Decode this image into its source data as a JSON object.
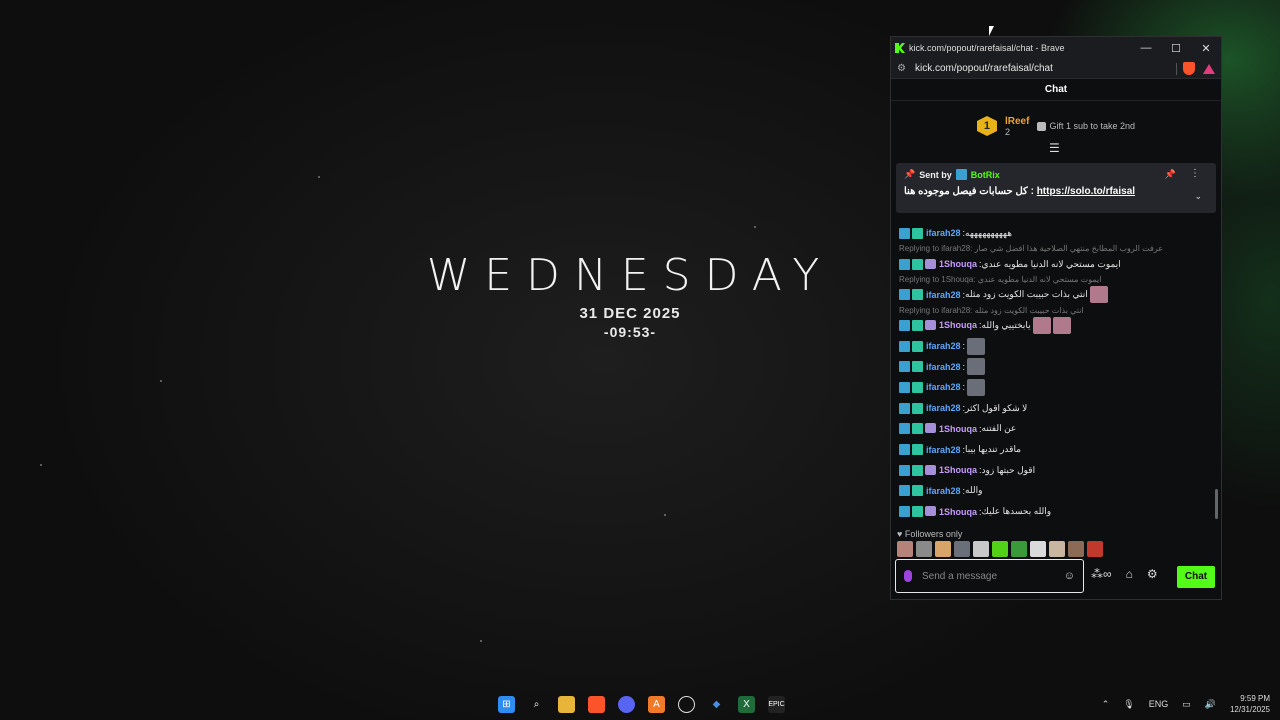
{
  "desktop": {
    "day": "WEDNESDAY",
    "date": "31 DEC 2025",
    "time": "-09:53-"
  },
  "browser": {
    "title": "kick.com/popout/rarefaisal/chat - Brave",
    "url": "kick.com/popout/rarefaisal/chat",
    "buttons": {
      "minimize": "—",
      "maximize": "☐",
      "close": "✕"
    }
  },
  "chat": {
    "header": "Chat",
    "leaderboard": {
      "rank": "1",
      "name": "lReef",
      "count": "2",
      "gift_text": "Gift 1 sub to take 2nd"
    },
    "pinned": {
      "sent_by": "Sent by",
      "bot_name": "BotRix",
      "text": "كل حسابات فيصل موجوده هنا : ",
      "link": "https://solo.to/rfaisal"
    },
    "messages": [
      {
        "type": "msg",
        "user": "ifarah28",
        "userclass": "u-farah",
        "badge3": false,
        "text": "ههههههههههه",
        "emotes": 0
      },
      {
        "type": "reply",
        "text": "Replying to ifarah28: عرفت الروب المطابخ منتهي الصلاحية هذا افضل شي صار"
      },
      {
        "type": "msg",
        "user": "1Shouqa",
        "userclass": "u-shouqa",
        "badge3": true,
        "text": "ايموت مستحي لانه الدنيا مطويه عندي",
        "emotes": 0
      },
      {
        "type": "reply",
        "text": "Replying to 1Shouqa: ايموت مستحي لانه الدنيا مطويه عندي"
      },
      {
        "type": "msg",
        "user": "ifarah28",
        "userclass": "u-farah",
        "badge3": false,
        "text": "انتي بذات حبيبت الكويت زود مثله",
        "emotes": 1
      },
      {
        "type": "reply",
        "text": "Replying to ifarah28: انتي بذات حبيبت الكويت زود مثله"
      },
      {
        "type": "msg",
        "user": "1Shouqa",
        "userclass": "u-shouqa",
        "badge3": true,
        "text": "يابختييي والله",
        "emotes": 2
      },
      {
        "type": "msg",
        "user": "ifarah28",
        "userclass": "u-farah",
        "badge3": false,
        "text": "",
        "emotes": 1
      },
      {
        "type": "msg",
        "user": "ifarah28",
        "userclass": "u-farah",
        "badge3": false,
        "text": "",
        "emotes": 1
      },
      {
        "type": "msg",
        "user": "ifarah28",
        "userclass": "u-farah",
        "badge3": false,
        "text": "",
        "emotes": 1
      },
      {
        "type": "msg",
        "user": "ifarah28",
        "userclass": "u-farah",
        "badge3": false,
        "text": "لا شكو اقول اكثر",
        "emotes": 0
      },
      {
        "type": "msg",
        "user": "1Shouqa",
        "userclass": "u-shouqa",
        "badge3": true,
        "text": "عن الفتنه",
        "emotes": 0
      },
      {
        "type": "msg",
        "user": "ifarah28",
        "userclass": "u-farah",
        "badge3": false,
        "text": "ماقدر تنديها بيبا",
        "emotes": 0
      },
      {
        "type": "msg",
        "user": "1Shouqa",
        "userclass": "u-shouqa",
        "badge3": true,
        "text": "اقول حبتها زود",
        "emotes": 0
      },
      {
        "type": "msg",
        "user": "ifarah28",
        "userclass": "u-farah",
        "badge3": false,
        "text": "والله",
        "emotes": 0
      },
      {
        "type": "msg",
        "user": "1Shouqa",
        "userclass": "u-shouqa",
        "badge3": true,
        "text": "والله بحسدها عليك",
        "emotes": 0
      }
    ],
    "followers_only": "♥ Followers only",
    "input_placeholder": "Send a message",
    "chat_button": "Chat",
    "emote_colors": [
      "#b5837a",
      "#8a8a8a",
      "#d9a46a",
      "#6b6f7a",
      "#c8c8c8",
      "#53d018",
      "#3a9a3a",
      "#dadada",
      "#c9b6a0",
      "#8b6b55",
      "#c0392b"
    ]
  },
  "taskbar": {
    "icons": [
      "windows-start",
      "search",
      "file-explorer",
      "brave",
      "discord",
      "app-a",
      "app-circle",
      "app-diamond",
      "app-excel",
      "epic-games"
    ],
    "language": "ENG",
    "clock_time": "9:59 PM",
    "clock_date": "12/31/2025"
  }
}
